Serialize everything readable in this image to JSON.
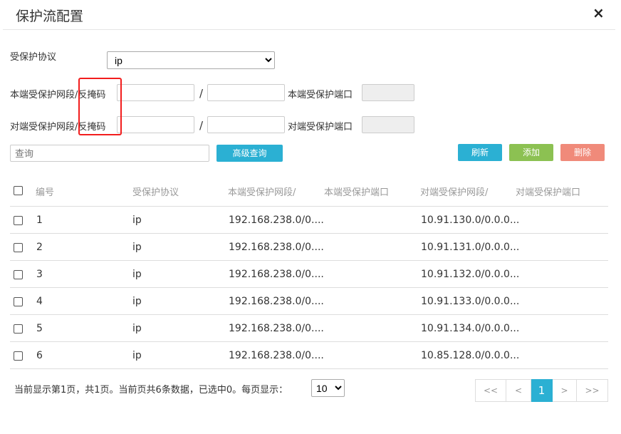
{
  "dialog": {
    "title": "保护流配置",
    "close_icon": "×"
  },
  "form": {
    "protocol_label": "受保护协议",
    "protocol_value": "ip",
    "local_net_label": "本端受保护网段/反掩码",
    "local_port_label": "本端受保护端口",
    "remote_net_label": "对端受保护网段/反掩码",
    "remote_port_label": "对端受保护端口",
    "slash": "/",
    "search_placeholder": "查询",
    "advanced_label": "高级查询",
    "refresh_label": "刷新",
    "add_label": "添加",
    "delete_label": "删除"
  },
  "colors": {
    "primary": "#2bb0d3",
    "add": "#8cc152",
    "delete": "#f08a7a",
    "highlight": "#f21d1d"
  },
  "table": {
    "headers": [
      "编号",
      "受保护协议",
      "本端受保护网段/",
      "本端受保护端口",
      "对端受保护网段/",
      "对端受保护端口"
    ],
    "rows": [
      {
        "id": "1",
        "protocol": "ip",
        "local": "192.168.238.0/0....",
        "local_port": "",
        "remote": "10.91.130.0/0.0.0...",
        "remote_port": ""
      },
      {
        "id": "2",
        "protocol": "ip",
        "local": "192.168.238.0/0....",
        "local_port": "",
        "remote": "10.91.131.0/0.0.0...",
        "remote_port": ""
      },
      {
        "id": "3",
        "protocol": "ip",
        "local": "192.168.238.0/0....",
        "local_port": "",
        "remote": "10.91.132.0/0.0.0...",
        "remote_port": ""
      },
      {
        "id": "4",
        "protocol": "ip",
        "local": "192.168.238.0/0....",
        "local_port": "",
        "remote": "10.91.133.0/0.0.0...",
        "remote_port": ""
      },
      {
        "id": "5",
        "protocol": "ip",
        "local": "192.168.238.0/0....",
        "local_port": "",
        "remote": "10.91.134.0/0.0.0...",
        "remote_port": ""
      },
      {
        "id": "6",
        "protocol": "ip",
        "local": "192.168.238.0/0....",
        "local_port": "",
        "remote": "10.85.128.0/0.0.0...",
        "remote_port": ""
      }
    ]
  },
  "footer": {
    "status": "当前显示第1页，共1页。当前页共6条数据，已选中0。每页显示：",
    "page_size": "10",
    "pager": {
      "first": "<<",
      "prev": "<",
      "current": "1",
      "next": ">",
      "last": ">>"
    }
  }
}
